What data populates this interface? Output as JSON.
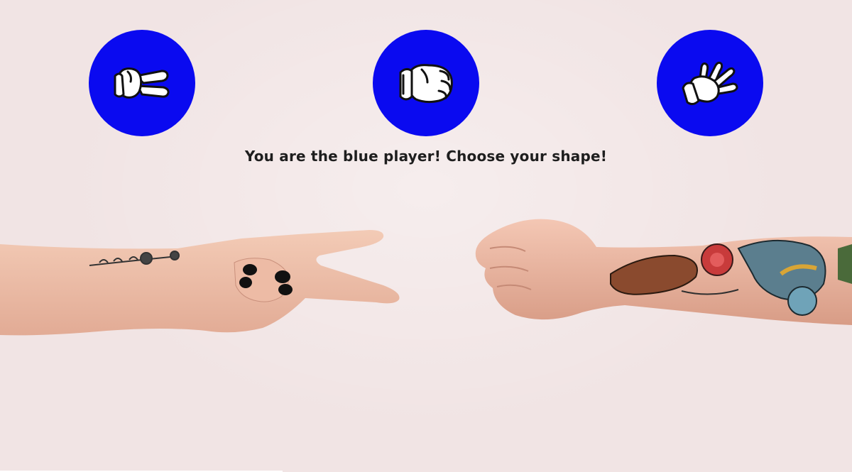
{
  "game": {
    "prompt": "You are the blue player! Choose your shape!",
    "accent_color": "#0a0af0",
    "background_color": "#f1e4e4"
  },
  "choices": [
    {
      "id": "scissors",
      "icon": "scissors-hand-icon"
    },
    {
      "id": "rock",
      "icon": "rock-fist-icon"
    },
    {
      "id": "paper",
      "icon": "paper-hand-icon"
    }
  ],
  "scene": {
    "left_hand": "scissors-gesture",
    "right_hand": "rock-gesture"
  }
}
